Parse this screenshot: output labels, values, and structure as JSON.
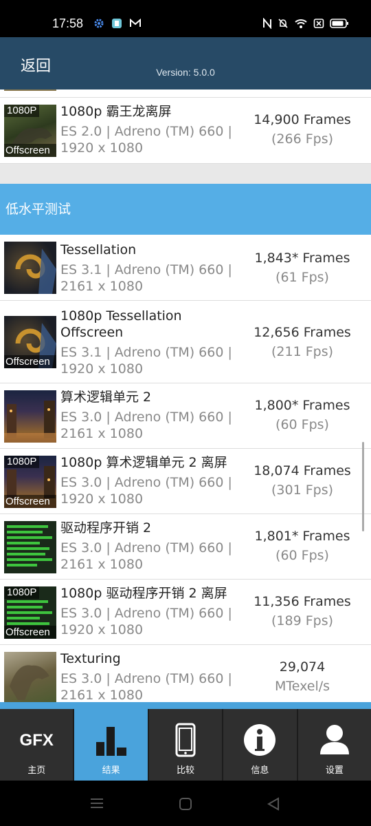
{
  "status_bar": {
    "time": "17:58",
    "icons_left": [
      "gear-icon",
      "app-icon",
      "gmail-icon"
    ],
    "icons_right": [
      "nfc-icon",
      "mute-icon",
      "wifi-icon",
      "sim-icon",
      "battery-icon"
    ]
  },
  "header": {
    "back_label": "返回",
    "version": "Version: 5.0.0"
  },
  "rows_top": [
    {
      "title": "1080p 霸王龙离屏",
      "sub1": "ES 2.0 | Adreno (TM) 660 |",
      "sub2": "1920 x 1080",
      "score": "14,900 Frames",
      "score_sub": "(266 Fps)",
      "badge_top": "1080P",
      "badge_bottom": "Offscreen"
    }
  ],
  "section": {
    "title": "低水平测试"
  },
  "rows": [
    {
      "title": "Tessellation",
      "sub1": "ES 3.1 | Adreno (TM) 660 |",
      "sub2": "2161 x 1080",
      "score": "1,843* Frames",
      "score_sub": "(61 Fps)"
    },
    {
      "title": "1080p Tessellation Offscreen",
      "sub1": "ES 3.1 | Adreno (TM) 660 |",
      "sub2": "1920 x 1080",
      "score": "12,656 Frames",
      "score_sub": "(211 Fps)",
      "badge_bottom": "Offscreen"
    },
    {
      "title": "算术逻辑单元 2",
      "sub1": "ES 3.0 | Adreno (TM) 660 |",
      "sub2": "2161 x 1080",
      "score": "1,800* Frames",
      "score_sub": "(60 Fps)"
    },
    {
      "title": "1080p 算术逻辑单元 2 离屏",
      "sub1": "ES 3.0 | Adreno (TM) 660 |",
      "sub2": "1920 x 1080",
      "score": "18,074 Frames",
      "score_sub": "(301 Fps)",
      "badge_top": "1080P",
      "badge_bottom": "Offscreen"
    },
    {
      "title": "驱动程序开销 2",
      "sub1": "ES 3.0 | Adreno (TM) 660 |",
      "sub2": "2161 x 1080",
      "score": "1,801* Frames",
      "score_sub": "(60 Fps)"
    },
    {
      "title": "1080p 驱动程序开销 2 离屏",
      "sub1": "ES 3.0 | Adreno (TM) 660 |",
      "sub2": "1920 x 1080",
      "score": "11,356 Frames",
      "score_sub": "(189 Fps)",
      "badge_top": "1080P",
      "badge_bottom": "Offscreen"
    },
    {
      "title": "Texturing",
      "sub1": "ES 3.0 | Adreno (TM) 660 |",
      "sub2": "2161 x 1080",
      "score": "29,074",
      "score_sub": "MTexel/s"
    }
  ],
  "tabs": [
    {
      "label": "主页",
      "logo": "GFX",
      "icon": "gfx-logo-icon"
    },
    {
      "label": "结果",
      "icon": "bar-chart-icon",
      "active": true
    },
    {
      "label": "比较",
      "icon": "phone-icon"
    },
    {
      "label": "信息",
      "icon": "info-icon"
    },
    {
      "label": "设置",
      "icon": "user-icon"
    }
  ],
  "nav_bar": {
    "icons": [
      "menu-icon",
      "home-icon",
      "back-icon"
    ]
  },
  "colors": {
    "header_bg": "#274a66",
    "section_bg": "#55aee6",
    "tab_active": "#4aa3dc",
    "tab_bg": "#2f2f2f"
  }
}
